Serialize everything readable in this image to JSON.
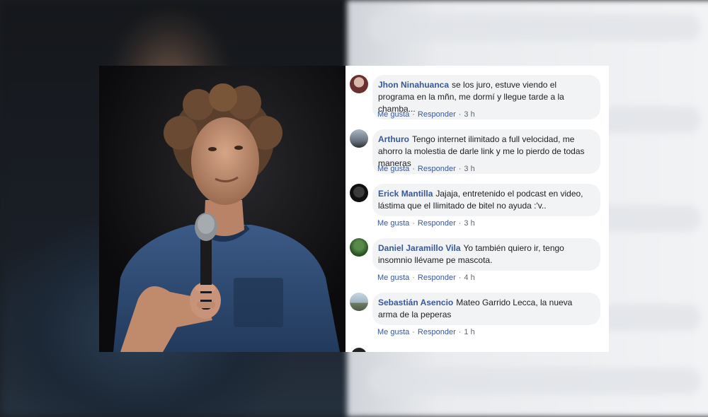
{
  "comments": [
    {
      "author": "Jhon Ninahuanca",
      "text": "se los juro, estuve viendo el programa en la mñn, me dormí y llegue tarde a la chamba...",
      "like_label": "Me gusta",
      "reply_label": "Responder",
      "time": "3 h"
    },
    {
      "author": "Arthuro",
      "text": "Tengo internet ilimitado a full velocidad, me ahorro la molestia de darle link y me lo pierdo de todas maneras",
      "like_label": "Me gusta",
      "reply_label": "Responder",
      "time": "3 h"
    },
    {
      "author": "Erick Mantilla",
      "text": "Jajaja, entretenido el podcast en video, lástima que el Ilimitado de bitel no ayuda :'v..",
      "like_label": "Me gusta",
      "reply_label": "Responder",
      "time": "3 h"
    },
    {
      "author": "Daniel Jaramillo Vila",
      "text": "Yo también quiero ir, tengo insomnio llévame pe mascota.",
      "like_label": "Me gusta",
      "reply_label": "Responder",
      "time": "4 h"
    },
    {
      "author": "Sebastián Asencio",
      "text": "Mateo Garrido Lecca, la nueva arma de la peperas",
      "like_label": "Me gusta",
      "reply_label": "Responder",
      "time": "1 h"
    }
  ],
  "colors": {
    "name_link": "#385898",
    "bubble_bg": "#f2f3f5",
    "meta_text": "#606770"
  }
}
